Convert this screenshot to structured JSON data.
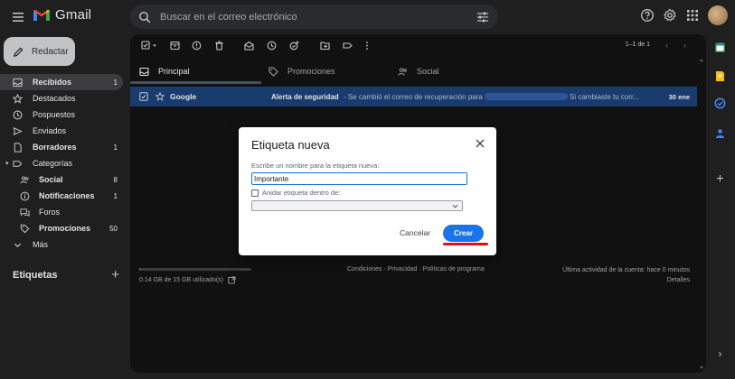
{
  "app": {
    "name": "Gmail"
  },
  "search": {
    "placeholder": "Buscar en el correo electrónico"
  },
  "compose": {
    "label": "Redactar"
  },
  "sidebar": {
    "items": [
      {
        "label": "Recibidos",
        "count": "1",
        "icon": "inbox-icon"
      },
      {
        "label": "Destacados",
        "count": "",
        "icon": "star-icon"
      },
      {
        "label": "Pospuestos",
        "count": "",
        "icon": "clock-icon"
      },
      {
        "label": "Enviados",
        "count": "",
        "icon": "send-icon"
      },
      {
        "label": "Borradores",
        "count": "1",
        "icon": "draft-icon"
      },
      {
        "label": "Categorías",
        "count": "",
        "icon": "label-icon"
      },
      {
        "label": "Social",
        "count": "8",
        "icon": "people-icon"
      },
      {
        "label": "Notificaciones",
        "count": "1",
        "icon": "info-icon"
      },
      {
        "label": "Foros",
        "count": "",
        "icon": "forum-icon"
      },
      {
        "label": "Promociones",
        "count": "50",
        "icon": "tag-icon"
      },
      {
        "label": "Más",
        "count": "",
        "icon": "chevron-down-icon"
      }
    ],
    "labels_heading": "Etiquetas"
  },
  "toolbar": {
    "pager": "1–1 de 1"
  },
  "tabs": [
    {
      "label": "Principal"
    },
    {
      "label": "Promociones"
    },
    {
      "label": "Social"
    }
  ],
  "mail": {
    "sender": "Google",
    "subject": "Alerta de seguridad",
    "snippet": "- Se cambió el correo de recuperación para",
    "snippet2": "Si cambiaste tu corr...",
    "date": "30 ene"
  },
  "footer": {
    "storage": "0.14 GB de 15 GB utilizado(s)",
    "storage_fraction": 0.01,
    "links": "Condiciones · Privacidad · Políticas de programa",
    "activity_line1": "Última actividad de la cuenta: hace 0 minutos",
    "activity_line2": "Detalles"
  },
  "dialog": {
    "title": "Etiqueta nueva",
    "field_label": "Escribe un nombre para la etiqueta nueva:",
    "field_value": "Importante",
    "nest_label": "Anidar etiqueta dentro de:",
    "cancel_label": "Cancelar",
    "create_label": "Crear"
  },
  "colors": {
    "accent": "#1a73e8",
    "selected_row": "#1a3b6e",
    "highlight_underline": "#e01010"
  }
}
